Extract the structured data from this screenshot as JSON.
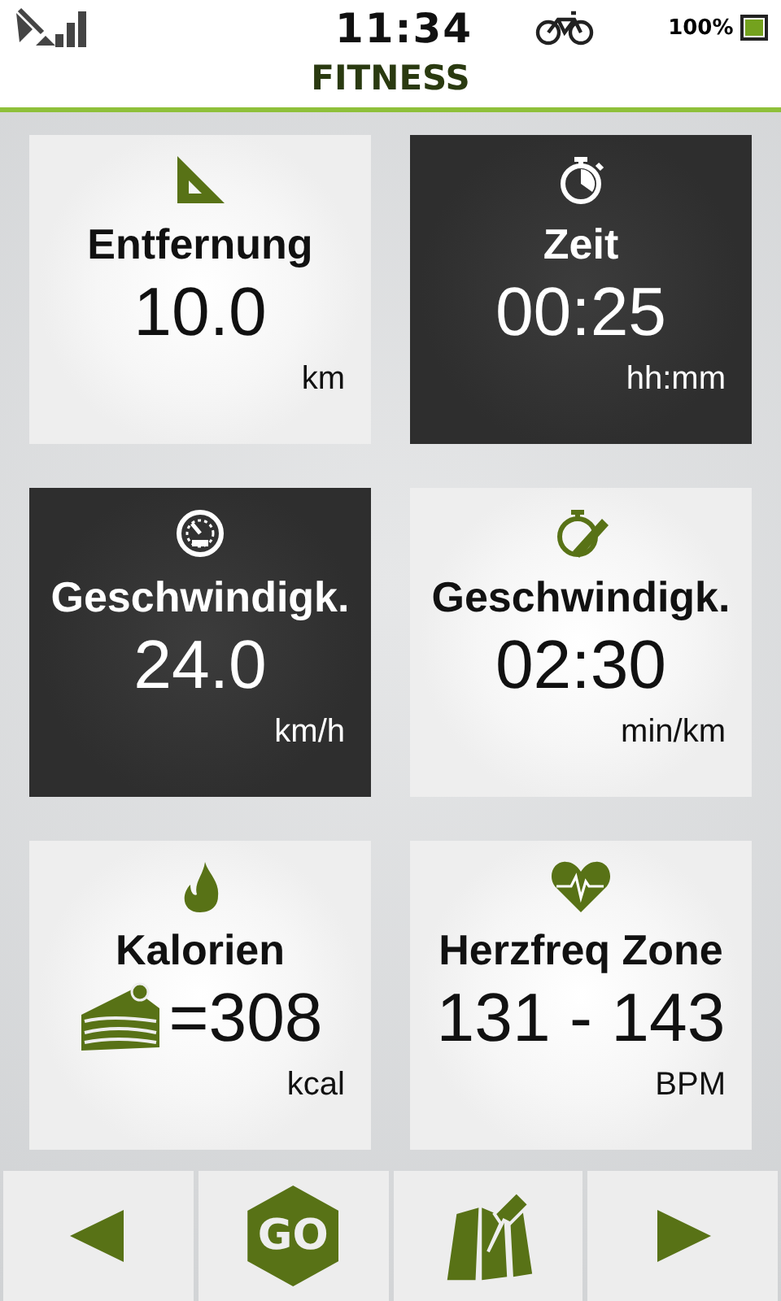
{
  "status_bar": {
    "time": "11:34",
    "battery": "100%"
  },
  "title": "FITNESS",
  "tiles": [
    {
      "label": "Entfernung",
      "value": "10.0",
      "unit": "km",
      "selected": false
    },
    {
      "label": "Zeit",
      "value": "00:25",
      "unit": "hh:mm",
      "selected": true
    },
    {
      "label": "Geschwindigk.",
      "value": "24.0",
      "unit": "km/h",
      "selected": true
    },
    {
      "label": "Geschwindigk.",
      "value": "02:30",
      "unit": "min/km",
      "selected": false
    },
    {
      "label": "Kalorien",
      "value": "=308",
      "unit": "kcal",
      "selected": false
    },
    {
      "label": "Herzfreq Zone",
      "value": "131 - 143",
      "unit": "BPM",
      "selected": false
    }
  ],
  "bottom_buttons": [
    {
      "kind": "back"
    },
    {
      "kind": "go",
      "label": "GO"
    },
    {
      "kind": "map"
    },
    {
      "kind": "forward"
    }
  ]
}
